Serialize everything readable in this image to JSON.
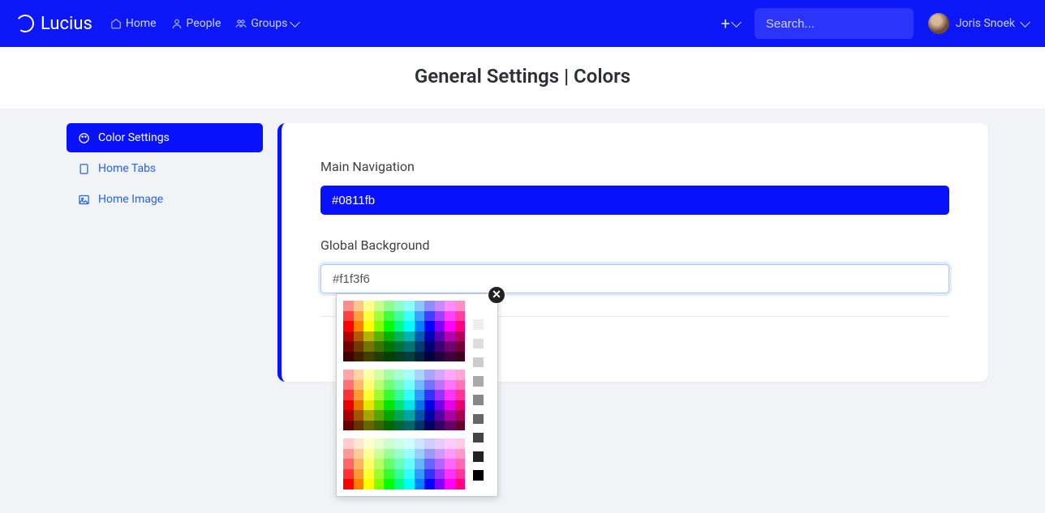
{
  "brand": "Lucius",
  "nav": {
    "home": "Home",
    "people": "People",
    "groups": "Groups"
  },
  "search": {
    "placeholder": "Search..."
  },
  "user": {
    "name": "Joris Snoek"
  },
  "page_title": "General Settings | Colors",
  "sidebar": {
    "items": [
      {
        "label": "Color Settings"
      },
      {
        "label": "Home Tabs"
      },
      {
        "label": "Home Image"
      }
    ]
  },
  "fields": {
    "main_nav": {
      "label": "Main Navigation",
      "value": "#0811fb"
    },
    "global_bg": {
      "label": "Global Background",
      "value": "#f1f3f6"
    }
  },
  "picker": {
    "hues": [
      "#ff0000",
      "#ff8000",
      "#ffff00",
      "#80ff00",
      "#00ff00",
      "#00ff80",
      "#00ffff",
      "#0080ff",
      "#0000ff",
      "#8000ff",
      "#ff00ff",
      "#ff0080"
    ],
    "grays": [
      "#ffffff",
      "#eeeeee",
      "#dddddd",
      "#cccccc",
      "#aaaaaa",
      "#888888",
      "#666666",
      "#444444",
      "#222222",
      "#000000"
    ]
  }
}
